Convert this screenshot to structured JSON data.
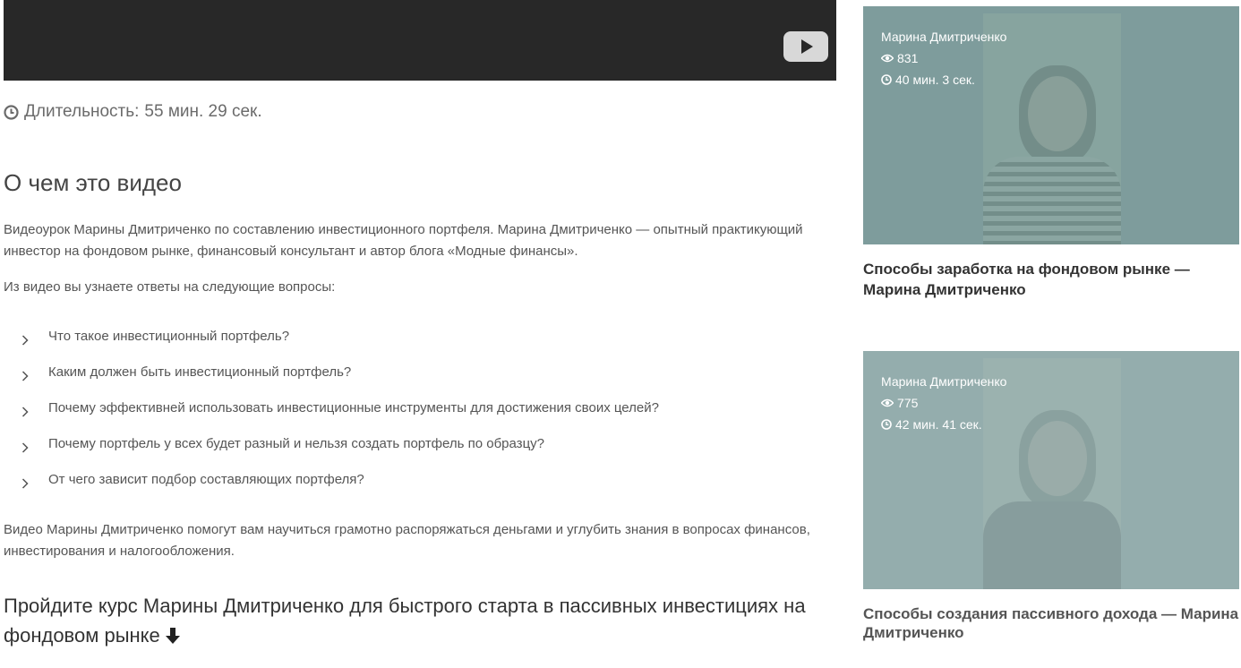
{
  "video": {
    "duration_label": "Длительность:",
    "duration_value": "55 мин. 29 сек."
  },
  "about": {
    "title": "О чем это видео",
    "intro": "Видеоурок Марины Дмитриченко по составлению инвестиционного портфеля. Марина Дмитриченко — опытный практикующий инвестор на фондовом рынке, финансовый консультант и автор блога «Модные финансы».",
    "questions_lead": "Из видео вы узнаете ответы на следующие вопросы:",
    "questions": [
      "Что такое инвестиционный портфель?",
      "Каким должен быть инвестиционный портфель?",
      "Почему эффективней использовать инвестиционные инструменты для достижения своих целей?",
      "Почему портфель у всех будет разный и нельзя создать портфель по образцу?",
      "От чего зависит подбор составляющих портфеля?"
    ],
    "outro": "Видео Марины Дмитриченко помогут вам научиться грамотно распоряжаться деньгами и углубить знания в вопросах финансов, инвестирования и налогообложения.",
    "course_heading": "Пройдите курс Марины Дмитриченко для быстрого старта в пассивных инвестициях на фондовом рынке"
  },
  "sidebar": {
    "cards": [
      {
        "author": "Марина Дмитриченко",
        "views": "831",
        "duration": "40 мин. 3 сек.",
        "title": "Способы заработка на фондовом рынке — Марина Дмитриченко"
      },
      {
        "author": "Марина Дмитриченко",
        "views": "775",
        "duration": "42 мин. 41 сек.",
        "title": "Способы создания пассивного дохода — Марина Дмитриченко"
      }
    ]
  },
  "icons": {
    "play": "play-icon",
    "clock": "clock-icon",
    "eye": "eye-icon",
    "chevron": "chevron-right-icon",
    "arrow": "arrow-down-icon"
  },
  "colors": {
    "player_bg": "#282828",
    "text": "#555555",
    "heading": "#333333",
    "thumb_1": "#7e9b9b",
    "thumb_2": "#9bb2b2"
  }
}
